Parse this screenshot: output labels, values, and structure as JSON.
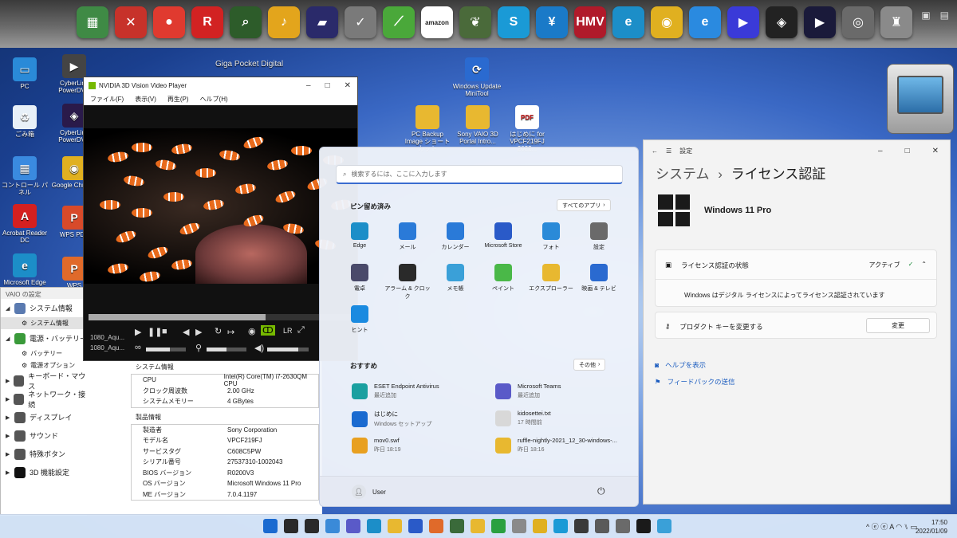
{
  "dock": {
    "caption": "Giga Pocket Digital",
    "icons": [
      {
        "name": "vaio-care-icon",
        "color": "#3f8a45",
        "glyph": "▦"
      },
      {
        "name": "media-gallery-icon",
        "color": "#c7322a",
        "glyph": "✕"
      },
      {
        "name": "dvd-burner-icon",
        "color": "#e03a2f",
        "glyph": "●"
      },
      {
        "name": "r-app-icon",
        "color": "#d22222",
        "glyph": "R"
      },
      {
        "name": "giga-pocket-digital-icon",
        "color": "#2d5c2a",
        "glyph": "⌕"
      },
      {
        "name": "music-icon",
        "color": "#e3a51c",
        "glyph": "♪"
      },
      {
        "name": "photo-icon",
        "color": "#2a2a6a",
        "glyph": "▰"
      },
      {
        "name": "checklist-icon",
        "color": "#7a7a7a",
        "glyph": "✓"
      },
      {
        "name": "green-app-icon",
        "color": "#4aa83a",
        "glyph": "⟋"
      },
      {
        "name": "amazon-icon",
        "color": "#ffffff",
        "glyph": "amazon"
      },
      {
        "name": "evernote-icon",
        "color": "#4a6a3a",
        "glyph": "❦"
      },
      {
        "name": "skype-icon",
        "color": "#1a9ad6",
        "glyph": "S"
      },
      {
        "name": "yen-icon",
        "color": "#1a7ac8",
        "glyph": "¥"
      },
      {
        "name": "hmv-icon",
        "color": "#b01a2a",
        "glyph": "HMV"
      },
      {
        "name": "edge-icon",
        "color": "#1c8ec8",
        "glyph": "e"
      },
      {
        "name": "chrome-icon",
        "color": "#e0b020",
        "glyph": "◉"
      },
      {
        "name": "ie-icon",
        "color": "#2a8ae0",
        "glyph": "e"
      },
      {
        "name": "play-icon",
        "color": "#3a3ad8",
        "glyph": "▶"
      },
      {
        "name": "cyberlink-icon",
        "color": "#222222",
        "glyph": "◈"
      },
      {
        "name": "powerdvd-icon",
        "color": "#1a1a3a",
        "glyph": "▶"
      },
      {
        "name": "webcam-icon",
        "color": "#6a6a6a",
        "glyph": "◎"
      },
      {
        "name": "paint-icon",
        "color": "#8a8a8a",
        "glyph": "♜"
      }
    ]
  },
  "desktop": {
    "icons": [
      {
        "label": "PC",
        "color": "#2a8ad8",
        "glyph": "▭"
      },
      {
        "label": "CyberLink PowerDVD",
        "color": "#444",
        "glyph": "▶"
      },
      {
        "label": "ごみ箱",
        "color": "#e8f0f8",
        "glyph": "♻"
      },
      {
        "label": "CyberLink PowerDVD",
        "color": "#2a1a4a",
        "glyph": "◈"
      },
      {
        "label": "コントロール パネル",
        "color": "#3a8ae0",
        "glyph": "▦"
      },
      {
        "label": "Google Chrome",
        "color": "#e0b020",
        "glyph": "◉"
      },
      {
        "label": "Acrobat Reader DC",
        "color": "#d42020",
        "glyph": "A"
      },
      {
        "label": "WPS PDF",
        "color": "#d84a2a",
        "glyph": "P"
      },
      {
        "label": "Microsoft Edge",
        "color": "#1c8ec8",
        "glyph": "e"
      },
      {
        "label": "WPS Presentation",
        "color": "#e06a2a",
        "glyph": "P"
      },
      {
        "label": "Windows Update MiniTool",
        "color": "#2a6ad0",
        "glyph": "⟳"
      },
      {
        "label": "PC Backup Image ショートカット",
        "color": "#e8b830",
        "glyph": ""
      },
      {
        "label": "Sony VAIO 3D Portal Intro...",
        "color": "#e8b830",
        "glyph": ""
      },
      {
        "label": "はじめに for VPCF219FJ 2022...",
        "color": "#ffffff",
        "glyph": "PDF"
      }
    ]
  },
  "vaio": {
    "title": "VAIO の設定",
    "tree": [
      {
        "label": "システム情報",
        "expanded": true,
        "color": "#5a7ab0",
        "children": [
          "システム情報"
        ]
      },
      {
        "label": "電源・バッテリー",
        "expanded": true,
        "color": "#3a9a3a",
        "children": [
          "バッテリー",
          "電源オプション"
        ]
      },
      {
        "label": "キーボード・マウス",
        "expanded": false,
        "color": "#555"
      },
      {
        "label": "ネットワーク・接続",
        "expanded": false,
        "color": "#555"
      },
      {
        "label": "ディスプレイ",
        "expanded": false,
        "color": "#555"
      },
      {
        "label": "サウンド",
        "expanded": false,
        "color": "#555"
      },
      {
        "label": "特殊ボタン",
        "expanded": false,
        "color": "#555"
      },
      {
        "label": "3D 機能設定",
        "expanded": false,
        "color": "#111"
      }
    ],
    "system_info": {
      "heading": "システム情報",
      "rows": [
        {
          "k": "CPU",
          "v": "Intel(R) Core(TM) i7-2630QM CPU"
        },
        {
          "k": "クロック周波数",
          "v": "2.00 GHz"
        },
        {
          "k": "システムメモリー",
          "v": "4 GBytes"
        }
      ]
    },
    "product_info": {
      "heading": "製品情報",
      "rows": [
        {
          "k": "製造者",
          "v": "Sony Corporation"
        },
        {
          "k": "モデル名",
          "v": "VPCF219FJ"
        },
        {
          "k": "サービスタグ",
          "v": "C608C5PW"
        },
        {
          "k": "シリアル番号",
          "v": "27537310-1002043"
        },
        {
          "k": "BIOS バージョン",
          "v": "R0200V3"
        },
        {
          "k": "OS バージョン",
          "v": "Microsoft Windows 11 Pro"
        },
        {
          "k": "ME バージョン",
          "v": "7.0.4.1197"
        }
      ]
    }
  },
  "player": {
    "title": "NVIDIA 3D Vision Video Player",
    "menu": [
      "ファイル(F)",
      "表示(V)",
      "再生(P)",
      "ヘルプ(H)"
    ],
    "file1": "1080_Aqu...",
    "file2": "1080_Aqu...",
    "progress": 0.67,
    "volume": 0.75
  },
  "start": {
    "search_placeholder": "検索するには、ここに入力します",
    "pinned_heading": "ピン留め済み",
    "all_apps": "すべてのアプリ",
    "pinned": [
      {
        "label": "Edge",
        "color": "#1c8ec8"
      },
      {
        "label": "メール",
        "color": "#2a7ad8"
      },
      {
        "label": "カレンダー",
        "color": "#2a7ad8"
      },
      {
        "label": "Microsoft Store",
        "color": "#2a5ac8"
      },
      {
        "label": "フォト",
        "color": "#2a8ad8"
      },
      {
        "label": "設定",
        "color": "#6a6a6a"
      },
      {
        "label": "電卓",
        "color": "#4a4a6a"
      },
      {
        "label": "アラーム & クロック",
        "color": "#2a2a2a"
      },
      {
        "label": "メモ帳",
        "color": "#3aa0d8"
      },
      {
        "label": "ペイント",
        "color": "#4ab848"
      },
      {
        "label": "エクスプローラー",
        "color": "#e8b830"
      },
      {
        "label": "映画 & テレビ",
        "color": "#2a6ad0"
      },
      {
        "label": "ヒント",
        "color": "#1a8ae0"
      }
    ],
    "rec_heading": "おすすめ",
    "more": "その他",
    "recommended": [
      {
        "t1": "ESET Endpoint Antivirus",
        "t2": "最近追加",
        "color": "#1aa0a0"
      },
      {
        "t1": "Microsoft Teams",
        "t2": "最近追加",
        "color": "#5a5ac8"
      },
      {
        "t1": "はじめに",
        "t2": "Windows セットアップ",
        "color": "#1a6ad0"
      },
      {
        "t1": "kidosettei.txt",
        "t2": "17 時間前",
        "color": "#d8d8d8"
      },
      {
        "t1": "mov0.swf",
        "t2": "昨日 18:19",
        "color": "#e8a020"
      },
      {
        "t1": "ruffle-nightly-2021_12_30-windows-...",
        "t2": "昨日 18:16",
        "color": "#e8b830"
      }
    ],
    "user": "User"
  },
  "settings": {
    "app_title": "設定",
    "crumb_parent": "システム",
    "crumb_sep": "›",
    "crumb_current": "ライセンス認証",
    "edition": "Windows 11 Pro",
    "state_label": "ライセンス認証の状態",
    "state_value": "アクティブ",
    "state_detail": "Windows はデジタル ライセンスによってライセンス認証されています",
    "key_label": "プロダクト キーを変更する",
    "change_btn": "変更",
    "help": "ヘルプを表示",
    "feedback": "フィードバックの送信"
  },
  "taskbar": {
    "icons": [
      "#1a6ad0",
      "#2a2a2a",
      "#2a2a2a",
      "#3a8ad8",
      "#5a5ac8",
      "#1c8ec8",
      "#e8b830",
      "#2a5ac8",
      "#e06a2a",
      "#3a6a3a",
      "#e8b830",
      "#2aa040",
      "#8a8a8a",
      "#e0b020",
      "#1a9ad6",
      "#3a3a3a",
      "#5a5a5a",
      "#6a6a6a",
      "#1a1a1a",
      "#3aa0d8"
    ],
    "tray": "^ ⓔ ⓔ A  ◠ ⑊ ▭",
    "time": "17:50",
    "date": "2022/01/09"
  }
}
